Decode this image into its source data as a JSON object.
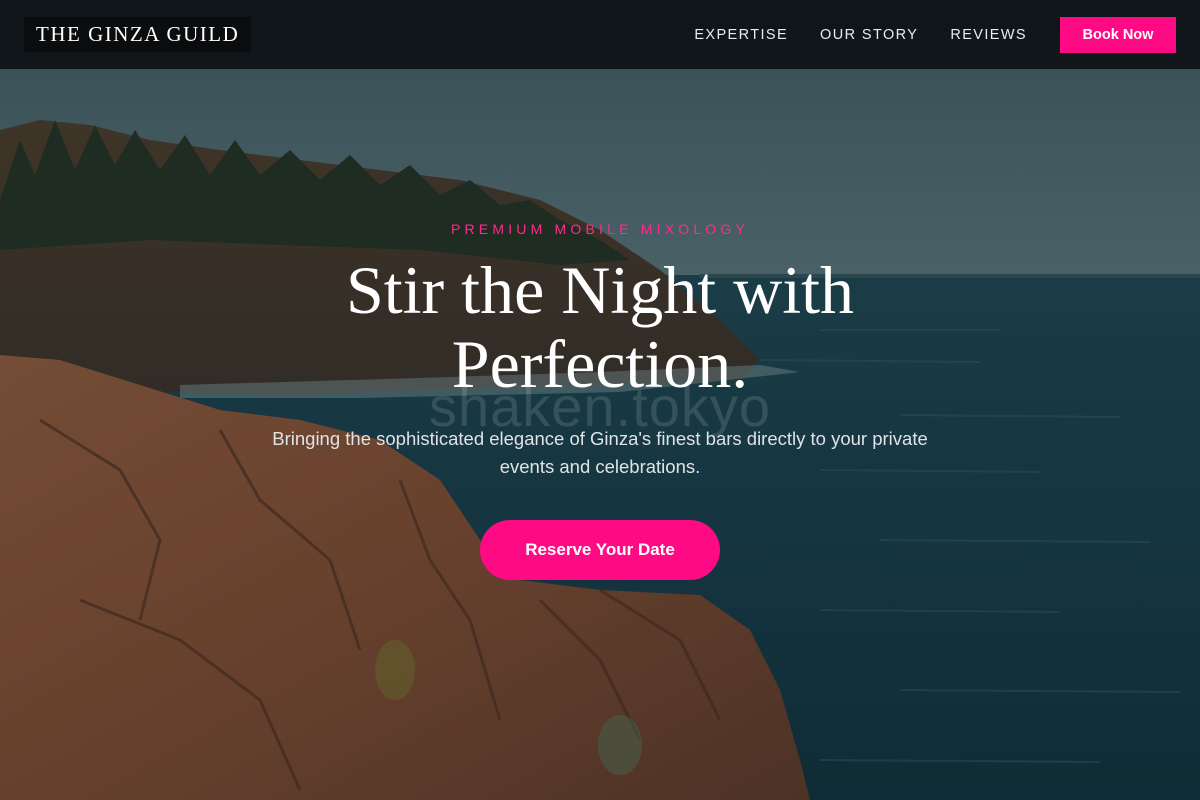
{
  "navbar": {
    "brand": "THE GINZA GUILD",
    "links": [
      {
        "label": "EXPERTISE"
      },
      {
        "label": "OUR STORY"
      },
      {
        "label": "REVIEWS"
      }
    ],
    "cta_label": "Book Now"
  },
  "hero": {
    "eyebrow": "PREMIUM MOBILE MIXOLOGY",
    "headline": "Stir the Night with Perfection.",
    "watermark": "shaken.tokyo",
    "subtext": "Bringing the sophisticated elegance of Ginza's finest bars directly to your private events and celebrations.",
    "cta_label": "Reserve Your Date"
  },
  "colors": {
    "accent": "#ff0a85",
    "navbar_bg": "#0e1216",
    "text_light": "#ffffff"
  }
}
